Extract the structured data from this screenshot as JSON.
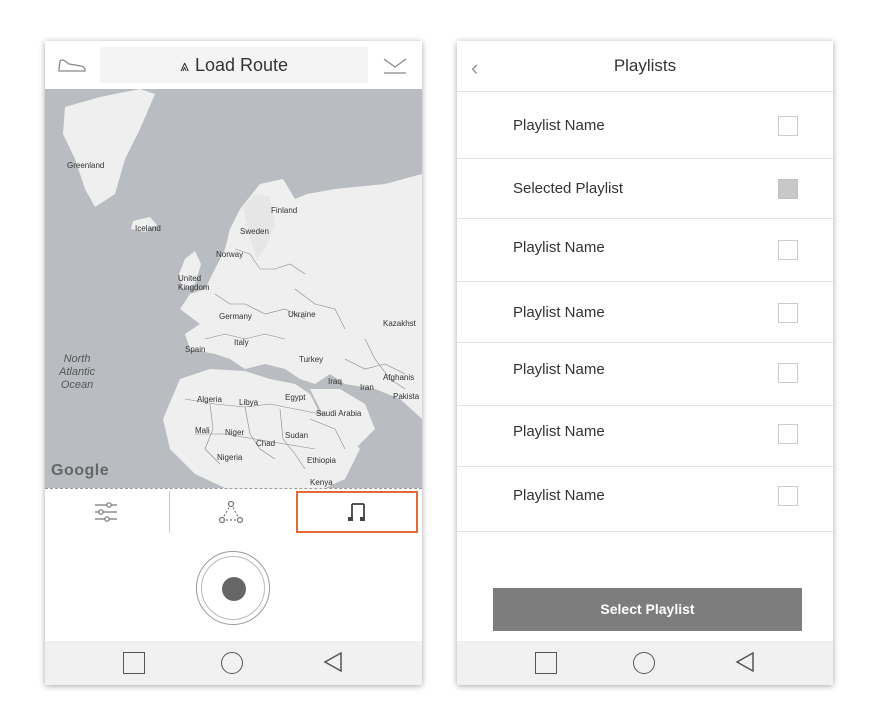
{
  "left_phone": {
    "header": {
      "title": "Load Route",
      "route_icon": "route-triangle-icon",
      "left_icon": "shoe-icon",
      "right_icon": "save-route-icon"
    },
    "map": {
      "labels": {
        "greenland": "Greenland",
        "iceland": "Iceland",
        "finland": "Finland",
        "sweden": "Sweden",
        "norway": "Norway",
        "uk": "United\nKingdom",
        "germany": "Germany",
        "ukraine": "Ukraine",
        "kazakhstan": "Kazakhst",
        "spain": "Spain",
        "italy": "Italy",
        "turkey": "Turkey",
        "iraq": "Iraq",
        "iran": "Iran",
        "afghanistan": "Afghanis",
        "pakistan": "Pakista",
        "algeria": "Algeria",
        "libya": "Libya",
        "egypt": "Egypt",
        "saudi": "Saudi Arabia",
        "mali": "Mali",
        "niger": "Niger",
        "chad": "Chad",
        "sudan": "Sudan",
        "nigeria": "Nigeria",
        "ethiopia": "Ethiopia",
        "kenya": "Kenya",
        "ocean": "North\nAtlantic\nOcean",
        "google": "Google"
      }
    },
    "tabs": [
      {
        "icon": "sliders-icon"
      },
      {
        "icon": "route-nodes-icon"
      },
      {
        "icon": "music-note-icon",
        "selected": true
      }
    ],
    "record_icon": "record-icon"
  },
  "right_phone": {
    "header": {
      "title": "Playlists",
      "back_icon": "chevron-left-icon"
    },
    "playlists": [
      {
        "name": "Playlist Name",
        "checked": false
      },
      {
        "name": "Selected Playlist",
        "checked": true
      },
      {
        "name": "Playlist Name",
        "checked": false
      },
      {
        "name": "Playlist Name",
        "checked": false
      },
      {
        "name": "Playlist Name",
        "checked": false
      },
      {
        "name": "Playlist Name",
        "checked": false
      },
      {
        "name": "Playlist Name",
        "checked": false
      }
    ],
    "select_button": "Select Playlist"
  },
  "nav": {
    "square": "recents-icon",
    "circle": "home-icon",
    "triangle": "back-icon"
  },
  "colors": {
    "accent": "#e36a37",
    "button": "#7d7d7d",
    "map": "#b9bdc1",
    "land": "#efefef"
  }
}
